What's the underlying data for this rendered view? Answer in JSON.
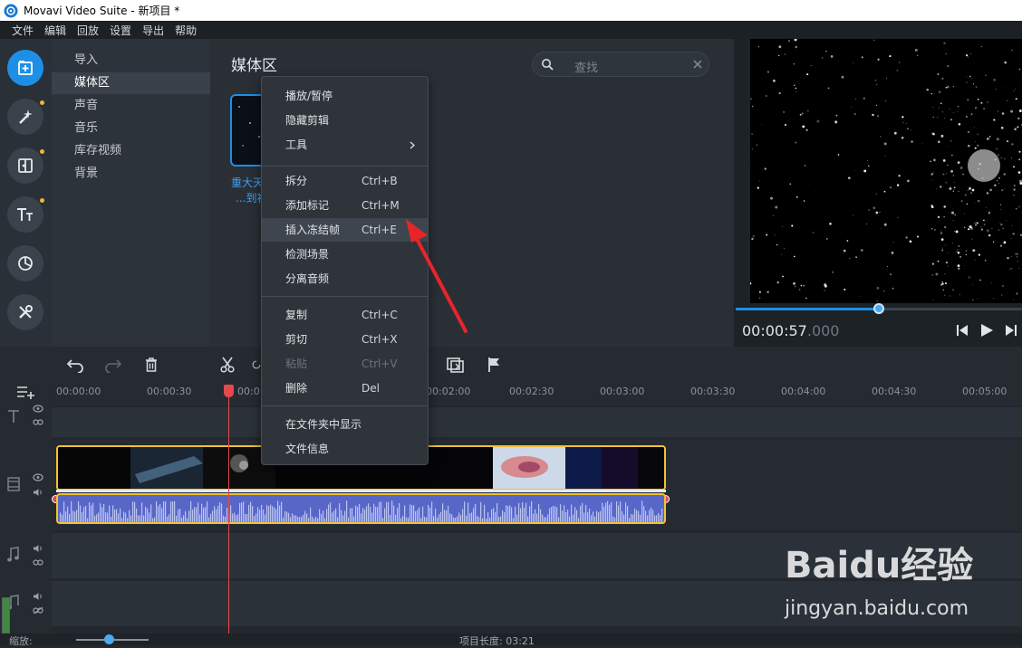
{
  "window": {
    "title": "Movavi Video Suite - 新项目 *"
  },
  "menu": [
    "文件",
    "编辑",
    "回放",
    "设置",
    "导出",
    "帮助"
  ],
  "sidenav": {
    "items": [
      "导入",
      "媒体区",
      "声音",
      "音乐",
      "库存视频",
      "背景"
    ],
    "selected": "媒体区"
  },
  "media": {
    "title": "媒体区",
    "search_placeholder": "查找",
    "thumb_caption_line1": "重大天",
    "thumb_caption_line2": "...到初"
  },
  "context_menu": {
    "groups": [
      [
        {
          "label": "播放/暂停",
          "shortcut": ""
        },
        {
          "label": "隐藏剪辑",
          "shortcut": ""
        },
        {
          "label": "工具",
          "shortcut": "",
          "submenu": true
        }
      ],
      [
        {
          "label": "拆分",
          "shortcut": "Ctrl+B"
        },
        {
          "label": "添加标记",
          "shortcut": "Ctrl+M"
        },
        {
          "label": "插入冻结帧",
          "shortcut": "Ctrl+E",
          "highlighted": true
        },
        {
          "label": "检测场景",
          "shortcut": ""
        },
        {
          "label": "分离音频",
          "shortcut": ""
        }
      ],
      [
        {
          "label": "复制",
          "shortcut": "Ctrl+C"
        },
        {
          "label": "剪切",
          "shortcut": "Ctrl+X"
        },
        {
          "label": "粘贴",
          "shortcut": "Ctrl+V",
          "disabled": true
        },
        {
          "label": "删除",
          "shortcut": "Del"
        }
      ],
      [
        {
          "label": "在文件夹中显示",
          "shortcut": ""
        },
        {
          "label": "文件信息",
          "shortcut": ""
        }
      ]
    ]
  },
  "player": {
    "time_main": "00:00:57",
    "time_ms": ".000",
    "progress_fraction": 0.5
  },
  "timeline": {
    "ruler_labels": [
      "00:00:00",
      "00:00:30",
      "00:0",
      "00:02:00",
      "00:02:30",
      "00:03:00",
      "00:03:30",
      "00:04:00",
      "00:04:30",
      "00:05:00"
    ]
  },
  "status": {
    "zoom_label": "缩放:",
    "project_length": "项目长度: 03:21"
  },
  "watermark": {
    "logo": "Baidu经验",
    "url": "jingyan.baidu.com"
  },
  "colors": {
    "accent": "#1e8fe6",
    "clip_border": "#f1c232",
    "playhead": "#e5484d",
    "audio": "#5867c7"
  }
}
